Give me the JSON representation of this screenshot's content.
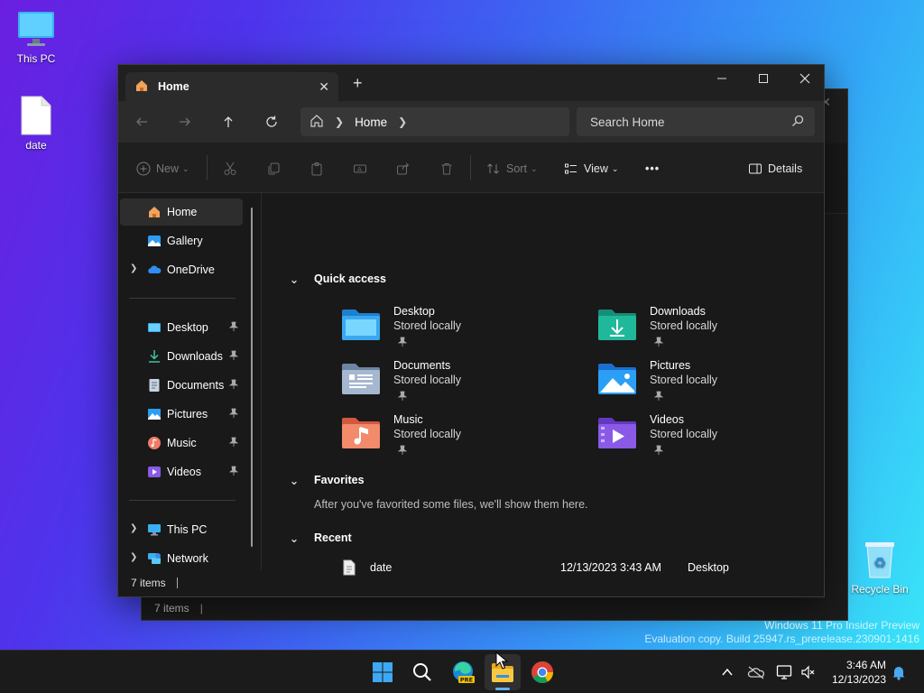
{
  "desktop": {
    "icons": [
      {
        "label": "This PC"
      },
      {
        "label": "date"
      },
      {
        "label": "Recycle Bin"
      }
    ],
    "watermark": {
      "line1": "Windows 11 Pro Insider Preview",
      "line2": "Evaluation copy. Build 25947.rs_prerelease.230901-1416"
    }
  },
  "background_window": {
    "status": "7 items"
  },
  "explorer": {
    "tab": {
      "label": "Home",
      "close": "✕"
    },
    "new_tab": "+",
    "caption": {
      "minimize": "—",
      "maximize": "☐",
      "close": "✕"
    },
    "address": {
      "crumbs": [
        "Home"
      ]
    },
    "search": {
      "placeholder": "Search Home"
    },
    "commands": {
      "new": "New",
      "sort": "Sort",
      "view": "View",
      "more": "•••",
      "details": "Details"
    },
    "sidebar": {
      "top": [
        {
          "label": "Home",
          "icon": "home-icon",
          "selected": true
        },
        {
          "label": "Gallery",
          "icon": "gallery-icon"
        },
        {
          "label": "OneDrive",
          "icon": "cloud-icon"
        }
      ],
      "pinned": [
        {
          "label": "Desktop",
          "icon": "desktop-folder-icon"
        },
        {
          "label": "Downloads",
          "icon": "download-icon"
        },
        {
          "label": "Documents",
          "icon": "document-icon"
        },
        {
          "label": "Pictures",
          "icon": "pictures-icon"
        },
        {
          "label": "Music",
          "icon": "music-icon"
        },
        {
          "label": "Videos",
          "icon": "videos-icon"
        }
      ],
      "bottom": [
        {
          "label": "This PC",
          "icon": "computer-icon"
        },
        {
          "label": "Network",
          "icon": "network-icon"
        }
      ]
    },
    "quick_access": {
      "title": "Quick access",
      "items": [
        {
          "name": "Desktop",
          "sub": "Stored locally",
          "color": "#3aa7f0"
        },
        {
          "name": "Downloads",
          "sub": "Stored locally",
          "color": "#1fb89a"
        },
        {
          "name": "Documents",
          "sub": "Stored locally",
          "color": "#8fa6c3"
        },
        {
          "name": "Pictures",
          "sub": "Stored locally",
          "color": "#2a9ff5"
        },
        {
          "name": "Music",
          "sub": "Stored locally",
          "color": "#f27a5e"
        },
        {
          "name": "Videos",
          "sub": "Stored locally",
          "color": "#8a5ae6"
        }
      ]
    },
    "favorites": {
      "title": "Favorites",
      "message": "After you've favorited some files, we'll show them here."
    },
    "recent": {
      "title": "Recent",
      "rows": [
        {
          "name": "date",
          "date": "12/13/2023 3:43 AM",
          "location": "Desktop"
        }
      ]
    },
    "status": "7 items"
  },
  "taskbar": {
    "time": "3:46 AM",
    "date": "12/13/2023",
    "edge_badge": "PRE"
  }
}
